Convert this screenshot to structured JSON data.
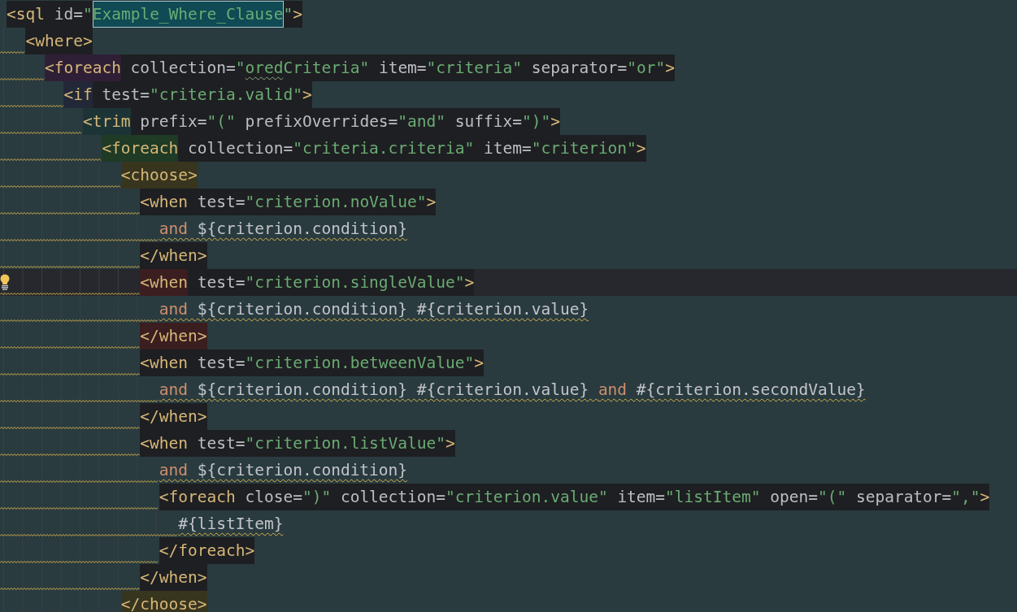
{
  "editor": {
    "lines": [
      {
        "box": true,
        "current": false,
        "bulb": false,
        "text_warning": false,
        "tokens": [
          {
            "kind": "tag",
            "text": "<sql"
          },
          {
            "kind": "attr",
            "text": " id="
          },
          {
            "kind": "value",
            "text": "\""
          },
          {
            "kind": "selection",
            "text": "Example_Where_Clause"
          },
          {
            "kind": "value",
            "text": "\""
          },
          {
            "kind": "tag",
            "text": ">"
          }
        ],
        "children": [
          {
            "box": true,
            "current": false,
            "bulb": false,
            "text_warning": false,
            "indent_warning": true,
            "tokens": [
              {
                "kind": "tag",
                "text": "<where>"
              }
            ],
            "children": [
              {
                "box": true,
                "current": false,
                "bulb": false,
                "text_warning": false,
                "indent_warning": true,
                "tokens": [
                  {
                    "kind": "tag",
                    "text": "<foreach",
                    "color": "#2f1f36",
                    "typo": false
                  },
                  {
                    "kind": "attr",
                    "text": " collection=",
                    "typo": false
                  },
                  {
                    "kind": "value",
                    "text": "\"",
                    "typo": false
                  },
                  {
                    "kind": "value",
                    "text": "ored",
                    "typo": true
                  },
                  {
                    "kind": "value",
                    "text": "Criteria\"",
                    "typo": false
                  },
                  {
                    "kind": "attr",
                    "text": " item=",
                    "typo": false
                  },
                  {
                    "kind": "value",
                    "text": "\"criteria\"",
                    "typo": false
                  },
                  {
                    "kind": "attr",
                    "text": " separator=",
                    "typo": false
                  },
                  {
                    "kind": "value",
                    "text": "\"or\"",
                    "typo": false
                  },
                  {
                    "kind": "tag",
                    "text": ">",
                    "typo": false
                  }
                ],
                "children": [
                  {
                    "box": true,
                    "current": false,
                    "bulb": false,
                    "text_warning": false,
                    "indent_warning": true,
                    "tokens": [
                      {
                        "kind": "tag",
                        "text": "<if",
                        "color": "#222838"
                      },
                      {
                        "kind": "attr",
                        "text": " test="
                      },
                      {
                        "kind": "value",
                        "text": "\"criteria.valid\""
                      },
                      {
                        "kind": "tag",
                        "text": ">"
                      }
                    ],
                    "children": [
                      {
                        "box": true,
                        "current": false,
                        "bulb": false,
                        "text_warning": false,
                        "indent_warning": true,
                        "tokens": [
                          {
                            "kind": "tag",
                            "text": "<trim",
                            "color": "#1d3436"
                          },
                          {
                            "kind": "attr",
                            "text": " prefix="
                          },
                          {
                            "kind": "value",
                            "text": "\"(\""
                          },
                          {
                            "kind": "attr",
                            "text": " prefixOverrides="
                          },
                          {
                            "kind": "value",
                            "text": "\"and\""
                          },
                          {
                            "kind": "attr",
                            "text": " suffix="
                          },
                          {
                            "kind": "value",
                            "text": "\")\""
                          },
                          {
                            "kind": "tag",
                            "text": ">"
                          }
                        ],
                        "children": [
                          {
                            "box": true,
                            "current": false,
                            "bulb": false,
                            "text_warning": false,
                            "indent_warning": true,
                            "tokens": [
                              {
                                "kind": "tag",
                                "text": "<foreach",
                                "color": "#1f3a25"
                              },
                              {
                                "kind": "attr",
                                "text": " collection="
                              },
                              {
                                "kind": "value",
                                "text": "\"criteria.criteria\""
                              },
                              {
                                "kind": "attr",
                                "text": " item="
                              },
                              {
                                "kind": "value",
                                "text": "\"criterion\""
                              },
                              {
                                "kind": "tag",
                                "text": ">"
                              }
                            ],
                            "children": [
                              {
                                "current": false,
                                "bulb": false,
                                "text_warning": false,
                                "indent_warning": true,
                                "tokens": [
                                  {
                                    "kind": "tag",
                                    "text": "<choose>",
                                    "color": "#38351f"
                                  }
                                ],
                                "children": [
                                  {
                                    "box": true,
                                    "current": false,
                                    "bulb": false,
                                    "text_warning": false,
                                    "indent_warning": true,
                                    "tokens": [
                                      {
                                        "kind": "tag",
                                        "text": "<when"
                                      },
                                      {
                                        "kind": "attr",
                                        "text": " test="
                                      },
                                      {
                                        "kind": "value",
                                        "text": "\"criterion.noValue\""
                                      },
                                      {
                                        "kind": "tag",
                                        "text": ">"
                                      }
                                    ],
                                    "children": [
                                      {
                                        "box": false,
                                        "current": false,
                                        "bulb": false,
                                        "text_warning": true,
                                        "indent_warning": true,
                                        "tokens": [
                                          {
                                            "kind": "keyword",
                                            "text": "and"
                                          },
                                          {
                                            "kind": "text",
                                            "text": " ${criterion.condition}"
                                          }
                                        ]
                                      }
                                    ]
                                  },
                                  {
                                    "box": true,
                                    "current": false,
                                    "bulb": false,
                                    "text_warning": false,
                                    "indent_warning": true,
                                    "tokens": [
                                      {
                                        "kind": "tag",
                                        "text": "</when>"
                                      }
                                    ]
                                  },
                                  {
                                    "box": true,
                                    "current": true,
                                    "bulb": true,
                                    "text_warning": false,
                                    "indent_warning": true,
                                    "tokens": [
                                      {
                                        "kind": "tag",
                                        "text": "<when",
                                        "color": "#3a1e20"
                                      },
                                      {
                                        "kind": "attr",
                                        "text": " test="
                                      },
                                      {
                                        "kind": "value",
                                        "text": "\"criterion.singleValue\""
                                      },
                                      {
                                        "kind": "tag",
                                        "text": ">"
                                      }
                                    ],
                                    "children": [
                                      {
                                        "box": false,
                                        "current": false,
                                        "bulb": false,
                                        "text_warning": true,
                                        "indent_warning": true,
                                        "tokens": [
                                          {
                                            "kind": "keyword",
                                            "text": "and"
                                          },
                                          {
                                            "kind": "text",
                                            "text": " ${criterion.condition} #{criterion.value}"
                                          }
                                        ]
                                      }
                                    ]
                                  },
                                  {
                                    "current": false,
                                    "bulb": false,
                                    "text_warning": false,
                                    "indent_warning": true,
                                    "tokens": [
                                      {
                                        "kind": "tag",
                                        "text": "</when>",
                                        "color": "#3a1e20"
                                      }
                                    ]
                                  },
                                  {
                                    "box": true,
                                    "current": false,
                                    "bulb": false,
                                    "text_warning": false,
                                    "indent_warning": true,
                                    "tokens": [
                                      {
                                        "kind": "tag",
                                        "text": "<when"
                                      },
                                      {
                                        "kind": "attr",
                                        "text": " test="
                                      },
                                      {
                                        "kind": "value",
                                        "text": "\"criterion.betweenValue\""
                                      },
                                      {
                                        "kind": "tag",
                                        "text": ">"
                                      }
                                    ],
                                    "children": [
                                      {
                                        "box": false,
                                        "current": false,
                                        "bulb": false,
                                        "text_warning": true,
                                        "indent_warning": true,
                                        "tokens": [
                                          {
                                            "kind": "keyword",
                                            "text": "and"
                                          },
                                          {
                                            "kind": "text",
                                            "text": " ${criterion.condition} #{criterion.value} "
                                          },
                                          {
                                            "kind": "keyword",
                                            "text": "and"
                                          },
                                          {
                                            "kind": "text",
                                            "text": " #{criterion.secondValue}"
                                          }
                                        ]
                                      }
                                    ]
                                  },
                                  {
                                    "box": true,
                                    "current": false,
                                    "bulb": false,
                                    "text_warning": false,
                                    "indent_warning": true,
                                    "tokens": [
                                      {
                                        "kind": "tag",
                                        "text": "</when>"
                                      }
                                    ]
                                  },
                                  {
                                    "box": true,
                                    "current": false,
                                    "bulb": false,
                                    "text_warning": false,
                                    "indent_warning": true,
                                    "tokens": [
                                      {
                                        "kind": "tag",
                                        "text": "<when"
                                      },
                                      {
                                        "kind": "attr",
                                        "text": " test="
                                      },
                                      {
                                        "kind": "value",
                                        "text": "\"criterion.listValue\""
                                      },
                                      {
                                        "kind": "tag",
                                        "text": ">"
                                      }
                                    ],
                                    "children": [
                                      {
                                        "box": false,
                                        "current": false,
                                        "bulb": false,
                                        "text_warning": true,
                                        "indent_warning": true,
                                        "tokens": [
                                          {
                                            "kind": "keyword",
                                            "text": "and"
                                          },
                                          {
                                            "kind": "text",
                                            "text": " ${criterion.condition}"
                                          }
                                        ]
                                      },
                                      {
                                        "box": true,
                                        "current": false,
                                        "bulb": false,
                                        "text_warning": false,
                                        "indent_warning": true,
                                        "tokens": [
                                          {
                                            "kind": "tag",
                                            "text": "<foreach"
                                          },
                                          {
                                            "kind": "attr",
                                            "text": " close="
                                          },
                                          {
                                            "kind": "value",
                                            "text": "\")\""
                                          },
                                          {
                                            "kind": "attr",
                                            "text": " collection="
                                          },
                                          {
                                            "kind": "value",
                                            "text": "\"criterion.value\""
                                          },
                                          {
                                            "kind": "attr",
                                            "text": " item="
                                          },
                                          {
                                            "kind": "value",
                                            "text": "\"listItem\""
                                          },
                                          {
                                            "kind": "attr",
                                            "text": " open="
                                          },
                                          {
                                            "kind": "value",
                                            "text": "\"(\""
                                          },
                                          {
                                            "kind": "attr",
                                            "text": " separator="
                                          },
                                          {
                                            "kind": "value",
                                            "text": "\",\""
                                          },
                                          {
                                            "kind": "tag",
                                            "text": ">"
                                          }
                                        ],
                                        "children": [
                                          {
                                            "box": false,
                                            "current": false,
                                            "bulb": false,
                                            "text_warning": true,
                                            "indent_warning": true,
                                            "tokens": [
                                              {
                                                "kind": "text",
                                                "text": "#{listItem}"
                                              }
                                            ]
                                          }
                                        ]
                                      },
                                      {
                                        "box": true,
                                        "current": false,
                                        "bulb": false,
                                        "text_warning": false,
                                        "indent_warning": true,
                                        "tokens": [
                                          {
                                            "kind": "tag",
                                            "text": "</foreach>"
                                          }
                                        ]
                                      }
                                    ]
                                  },
                                  {
                                    "box": true,
                                    "current": false,
                                    "bulb": false,
                                    "text_warning": false,
                                    "indent_warning": true,
                                    "tokens": [
                                      {
                                        "kind": "tag",
                                        "text": "</when>"
                                      }
                                    ]
                                  }
                                ]
                              },
                              {
                                "current": false,
                                "bulb": false,
                                "tokens": [
                                  {
                                    "kind": "tag",
                                    "text": "</choose>",
                                    "color": "#38351f"
                                  }
                                ]
                              }
                            ]
                          }
                        ]
                      }
                    ]
                  }
                ]
              }
            ]
          }
        ]
      }
    ]
  }
}
